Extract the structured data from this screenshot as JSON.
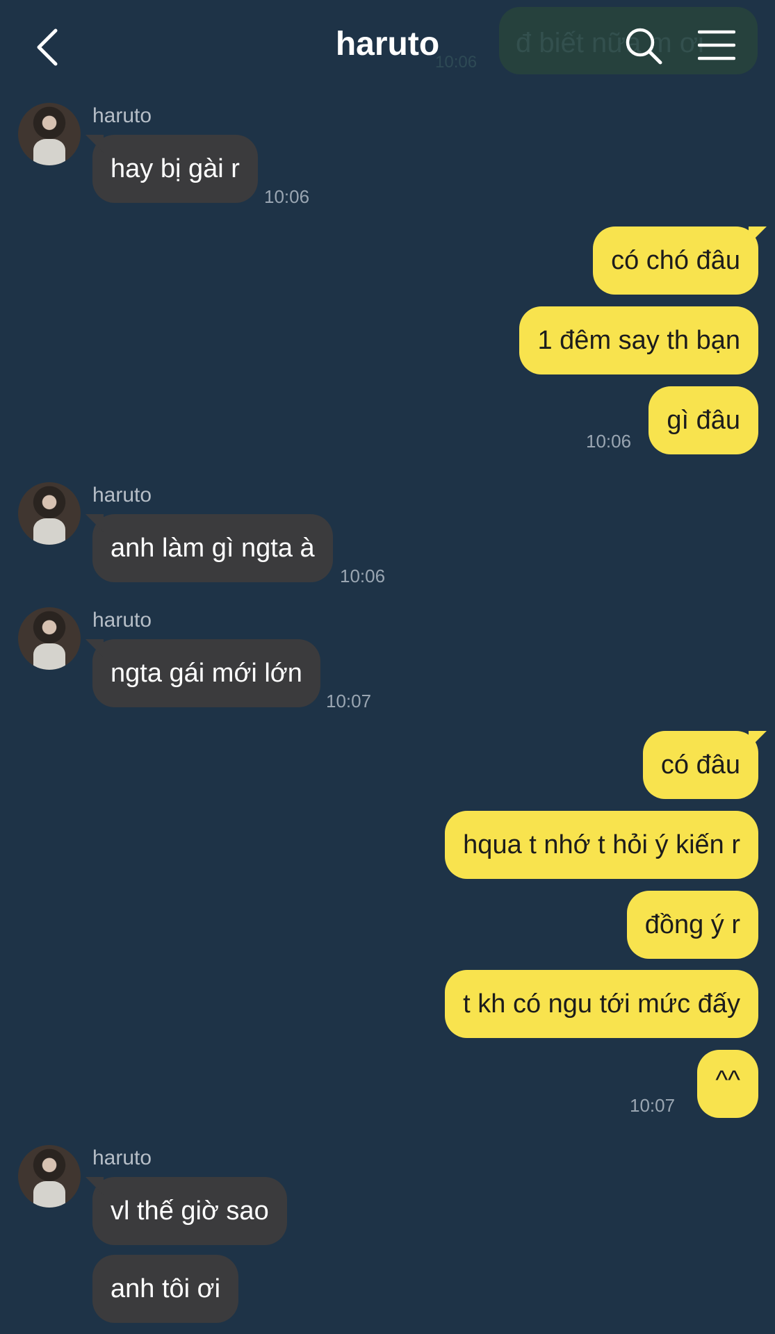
{
  "header": {
    "title": "haruto",
    "ghost_message": "đ biết nữa m ơi",
    "ghost_time": "10:06"
  },
  "messages": [
    {
      "sender": "haruto",
      "direction": "incoming",
      "text": "hay bị gài r",
      "time": "10:06"
    },
    {
      "direction": "outgoing",
      "text": "có chó đâu"
    },
    {
      "direction": "outgoing",
      "text": "1 đêm say th bạn"
    },
    {
      "direction": "outgoing",
      "text": "gì đâu",
      "time": "10:06"
    },
    {
      "sender": "haruto",
      "direction": "incoming",
      "text": "anh làm gì ngta à",
      "time": "10:06"
    },
    {
      "sender": "haruto",
      "direction": "incoming",
      "text": "ngta gái mới lớn",
      "time": "10:07"
    },
    {
      "direction": "outgoing",
      "text": "có đâu"
    },
    {
      "direction": "outgoing",
      "text": "hqua t nhớ t hỏi ý kiến r"
    },
    {
      "direction": "outgoing",
      "text": "đồng ý r"
    },
    {
      "direction": "outgoing",
      "text": "t kh có ngu tới mức đấy"
    },
    {
      "direction": "outgoing",
      "text": "^^",
      "time": "10:07"
    },
    {
      "sender": "haruto",
      "direction": "incoming",
      "text": "vl thế giờ sao"
    },
    {
      "direction": "incoming",
      "text": "anh tôi ơi"
    }
  ],
  "colors": {
    "background": "#1e3347",
    "incoming_bubble": "#3b3b3d",
    "outgoing_bubble": "#f8e34e"
  }
}
